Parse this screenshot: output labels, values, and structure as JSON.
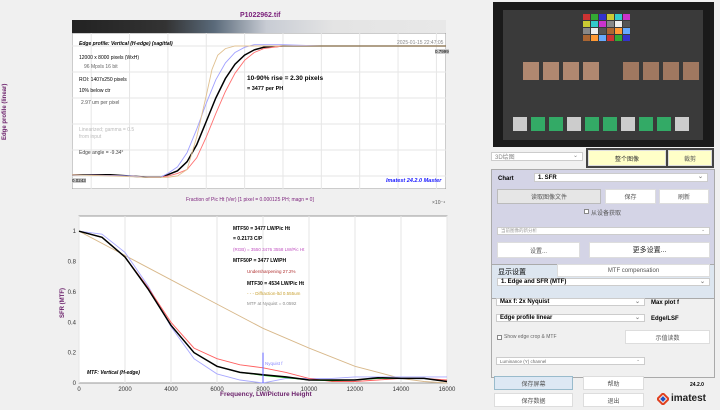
{
  "file_title": "P1022962.tif",
  "edge": {
    "subtitle": "Edge profile: Vertical (H-edge) (sagittal)",
    "timestamp": "2025-01-15 22:47:05",
    "info": [
      "12000 x 8000 pixels (WxH)",
      "96 Mpxls   16 bit",
      "ROI:  1407x250 pixels",
      "10% below ctr",
      "2.97 um per pixel",
      "Linearized; gamma = 0.5",
      "from input",
      "Edge angle = -9.34°"
    ],
    "rise": "10-90% rise = 2.30 pixels",
    "per_ph": "=   3477 per PH",
    "hi_val": "0.7999",
    "lo_val": "0.0243",
    "watermark": "Imatest 24.2.0 Master"
  },
  "mtf": {
    "lines": [
      "MTF50 = 3477 LW/Pic Ht",
      "= 0.2173 C/P",
      "(RGB) = 3550  3476  3558 LW/Pic Ht",
      "MTF50P = 3477 LW/PH",
      "Undersharpening 27.2%",
      "MTF30 = 4534 LW/Pic Ht",
      "- - - Diffraction-ltd  0.555um",
      "MTF at Nyquist = 0.0592"
    ],
    "nyquist_label": "Nyquist f",
    "caption": "MTF: Vertical (H-edge)"
  },
  "chart_data": [
    {
      "type": "line",
      "title": "P1022962.tif",
      "ylabel": "Edge profile (linear)",
      "xlabel": "Fraction of Pic Ht (Ver)   [1 pixel = 0.000125 PH; magn = 0]",
      "x_multiplier": "×10⁻⁴",
      "xlim": [
        -7,
        12.5
      ],
      "xticks": [
        -6,
        -4,
        -2,
        0,
        2,
        4,
        6,
        8,
        10,
        12
      ],
      "ylim": [
        -0.1,
        1.1
      ],
      "series": [
        {
          "name": "Y",
          "color": "#000000",
          "x": [
            -7,
            -5,
            -4,
            -3,
            -2.4,
            -2,
            -1.5,
            -1,
            -0.5,
            0,
            0.5,
            1,
            1.5,
            2,
            2.5,
            3,
            4,
            6,
            12.5
          ],
          "y": [
            0.01,
            0.01,
            0.0,
            -0.01,
            -0.01,
            0.01,
            0.04,
            0.11,
            0.24,
            0.42,
            0.6,
            0.75,
            0.86,
            0.93,
            0.97,
            0.99,
            1.0,
            1.0,
            1.0
          ]
        },
        {
          "name": "R",
          "color": "#ff7070",
          "x": [
            -7,
            -4,
            -3,
            -2.4,
            -2,
            -1.5,
            -1,
            -0.5,
            0,
            0.5,
            1,
            1.5,
            2,
            2.5,
            3,
            4,
            6,
            12.5
          ],
          "y": [
            0.01,
            0.0,
            -0.01,
            -0.01,
            0.0,
            0.02,
            0.05,
            0.14,
            0.3,
            0.48,
            0.65,
            0.79,
            0.89,
            0.95,
            0.98,
            1.0,
            1.0,
            1.0
          ]
        },
        {
          "name": "B",
          "color": "#a0a0ff",
          "x": [
            -7,
            -4,
            -3,
            -2.4,
            -2,
            -1.5,
            -1,
            -0.5,
            0,
            0.5,
            1,
            1.5,
            2,
            2.5,
            3,
            4,
            6,
            12.5
          ],
          "y": [
            0.01,
            0.0,
            -0.01,
            -0.01,
            0.02,
            0.07,
            0.18,
            0.36,
            0.56,
            0.74,
            0.87,
            0.95,
            0.99,
            1.01,
            1.01,
            1.01,
            1.0,
            1.0
          ]
        },
        {
          "name": "Diffraction",
          "color": "#e0c090",
          "x": [
            -7,
            -3,
            -2,
            -1.5,
            -1,
            -0.5,
            0,
            0.3,
            0.6,
            1,
            1.5,
            2,
            12.5
          ],
          "y": [
            0.01,
            -0.01,
            -0.01,
            0.0,
            0.05,
            0.3,
            0.62,
            0.82,
            0.93,
            0.98,
            1.0,
            1.0,
            1.0
          ]
        }
      ]
    },
    {
      "type": "line",
      "ylabel": "SFR (MTF)",
      "xlabel": "Frequency, LW/Picture Height",
      "xlim": [
        0,
        16000
      ],
      "ylim": [
        0,
        1.1
      ],
      "xticks": [
        0,
        2000,
        4000,
        6000,
        8000,
        10000,
        12000,
        14000,
        16000
      ],
      "yticks": [
        0,
        0.2,
        0.4,
        0.6,
        0.8,
        1
      ],
      "nyquist": 8000,
      "series": [
        {
          "name": "Diffraction",
          "color": "#d8b88a",
          "x": [
            0,
            2000,
            4000,
            6000,
            8000,
            10000,
            12000,
            14000,
            15000,
            16000
          ],
          "y": [
            1,
            0.84,
            0.68,
            0.52,
            0.36,
            0.23,
            0.11,
            0.03,
            0.01,
            0
          ]
        },
        {
          "name": "B",
          "color": "#a8a8ff",
          "x": [
            0,
            1000,
            2000,
            3000,
            4000,
            5000,
            6000,
            7000,
            8000,
            9000,
            10000,
            11000,
            12000,
            13000,
            14000,
            15000,
            16000
          ],
          "y": [
            1,
            0.98,
            0.86,
            0.64,
            0.37,
            0.16,
            0.06,
            0.02,
            0.0,
            0.03,
            0.03,
            0.03,
            0.04,
            0.04,
            0.04,
            0.04,
            0.04
          ]
        },
        {
          "name": "R",
          "color": "#ff6060",
          "x": [
            0,
            1000,
            2000,
            3000,
            4000,
            5000,
            6000,
            7000,
            8000,
            9000,
            10000,
            11000,
            12000,
            13000,
            14000,
            15000,
            16000
          ],
          "y": [
            1,
            0.96,
            0.83,
            0.63,
            0.4,
            0.23,
            0.16,
            0.12,
            0.1,
            0.07,
            0.03,
            0.01,
            0.01,
            0.02,
            0.03,
            0.03,
            0.02
          ]
        },
        {
          "name": "G",
          "color": "#00c000",
          "x": [
            0,
            1000,
            2000,
            3000,
            4000,
            5000,
            6000,
            7000,
            8000,
            9000,
            10000,
            11000,
            12000,
            13000,
            14000,
            15000,
            16000
          ],
          "y": [
            1,
            0.96,
            0.83,
            0.62,
            0.38,
            0.2,
            0.11,
            0.07,
            0.05,
            0.035,
            0.02,
            0.015,
            0.02,
            0.03,
            0.03,
            0.03,
            0.01
          ]
        },
        {
          "name": "Y",
          "color": "#000000",
          "x": [
            0,
            1000,
            2000,
            3000,
            4000,
            5000,
            6000,
            7000,
            8000,
            9000,
            10000,
            11000,
            12000,
            13000,
            14000,
            15000,
            16000
          ],
          "y": [
            1,
            0.96,
            0.83,
            0.62,
            0.38,
            0.2,
            0.11,
            0.07,
            0.055,
            0.04,
            0.02,
            0.02,
            0.02,
            0.035,
            0.03,
            0.03,
            0.01
          ]
        }
      ]
    }
  ],
  "panel": {
    "view_select": "3D绘图",
    "whole_image_btn": "整个图像",
    "crop_btn": "裁剪",
    "chart_label": "Chart",
    "chart_value": "1. SFR",
    "read_btn": "读取图像文件",
    "save_btn": "保存",
    "refresh_btn": "刷新",
    "acquire_label": "从设备获取",
    "analysis_select": "当前图像的新分析",
    "settings_btn": "设置...",
    "more_settings_btn": "更多设置...",
    "display_tab": "显示设置",
    "mtf_comp_tab": "MTF compensation",
    "display_select": "1. Edge and SFR (MTF)",
    "maxf_select": "Max f:    2x Nyquist",
    "maxf_label": "Max plot f",
    "edge_select": "Edge profile linear",
    "edge_label": "Edge/LSF",
    "show_crop_label": "Show edge crop & MTF",
    "readout_btn": "示值读数",
    "channel_select": "Luminance (Y) channel",
    "save_screen_btn": "保存屏幕",
    "help_btn": "帮助",
    "save_data_btn": "保存数据",
    "exit_btn": "退出",
    "version": "24.2.0",
    "logo": "imatest"
  }
}
